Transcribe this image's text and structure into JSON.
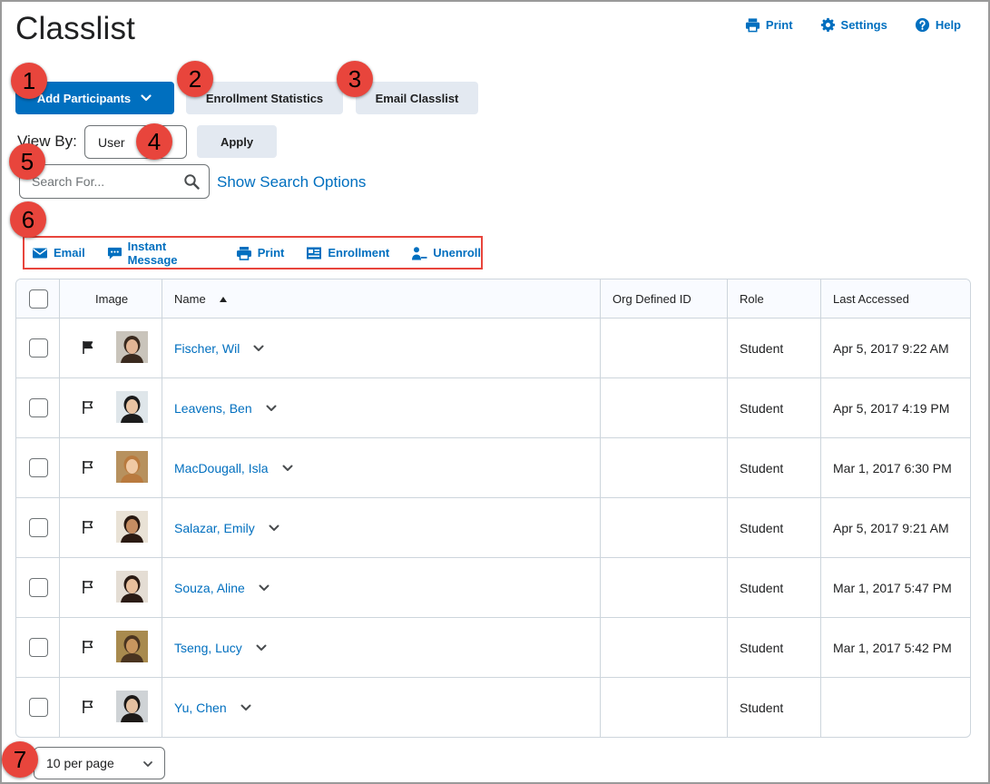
{
  "page": {
    "title": "Classlist"
  },
  "top_links": [
    {
      "label": "Print",
      "icon": "print-icon"
    },
    {
      "label": "Settings",
      "icon": "gear-icon"
    },
    {
      "label": "Help",
      "icon": "help-icon"
    }
  ],
  "buttons": {
    "add_participants": "Add Participants",
    "enrollment_statistics": "Enrollment Statistics",
    "email_classlist": "Email Classlist",
    "apply": "Apply"
  },
  "view_by": {
    "label": "View By:",
    "value": "User"
  },
  "search": {
    "placeholder": "Search For...",
    "options_link": "Show Search Options"
  },
  "actions": [
    {
      "label": "Email",
      "icon": "envelope-icon"
    },
    {
      "label": "Instant Message",
      "icon": "chat-icon"
    },
    {
      "label": "Print",
      "icon": "print-icon"
    },
    {
      "label": "Enrollment",
      "icon": "enrollment-icon"
    },
    {
      "label": "Unenroll",
      "icon": "unenroll-icon"
    }
  ],
  "table": {
    "columns": [
      "Image",
      "Name",
      "Org Defined ID",
      "Role",
      "Last Accessed"
    ],
    "rows": [
      {
        "name": "Fischer, Wil",
        "org_id": "",
        "role": "Student",
        "last_accessed": "Apr 5, 2017 9:22 AM",
        "flagged": true
      },
      {
        "name": "Leavens, Ben",
        "org_id": "",
        "role": "Student",
        "last_accessed": "Apr 5, 2017 4:19 PM",
        "flagged": false
      },
      {
        "name": "MacDougall, Isla",
        "org_id": "",
        "role": "Student",
        "last_accessed": "Mar 1, 2017 6:30 PM",
        "flagged": false
      },
      {
        "name": "Salazar, Emily",
        "org_id": "",
        "role": "Student",
        "last_accessed": "Apr 5, 2017 9:21 AM",
        "flagged": false
      },
      {
        "name": "Souza, Aline",
        "org_id": "",
        "role": "Student",
        "last_accessed": "Mar 1, 2017 5:47 PM",
        "flagged": false
      },
      {
        "name": "Tseng, Lucy",
        "org_id": "",
        "role": "Student",
        "last_accessed": "Mar 1, 2017 5:42 PM",
        "flagged": false
      },
      {
        "name": "Yu, Chen",
        "org_id": "",
        "role": "Student",
        "last_accessed": "",
        "flagged": false
      }
    ]
  },
  "pagination": {
    "per_page": "10 per page"
  },
  "callouts": [
    "1",
    "2",
    "3",
    "4",
    "5",
    "6",
    "7"
  ],
  "colors": {
    "accent": "#006fbf",
    "callout": "#e8453c",
    "secondary_button": "#e3e9f1",
    "border": "#cdd5dc"
  }
}
